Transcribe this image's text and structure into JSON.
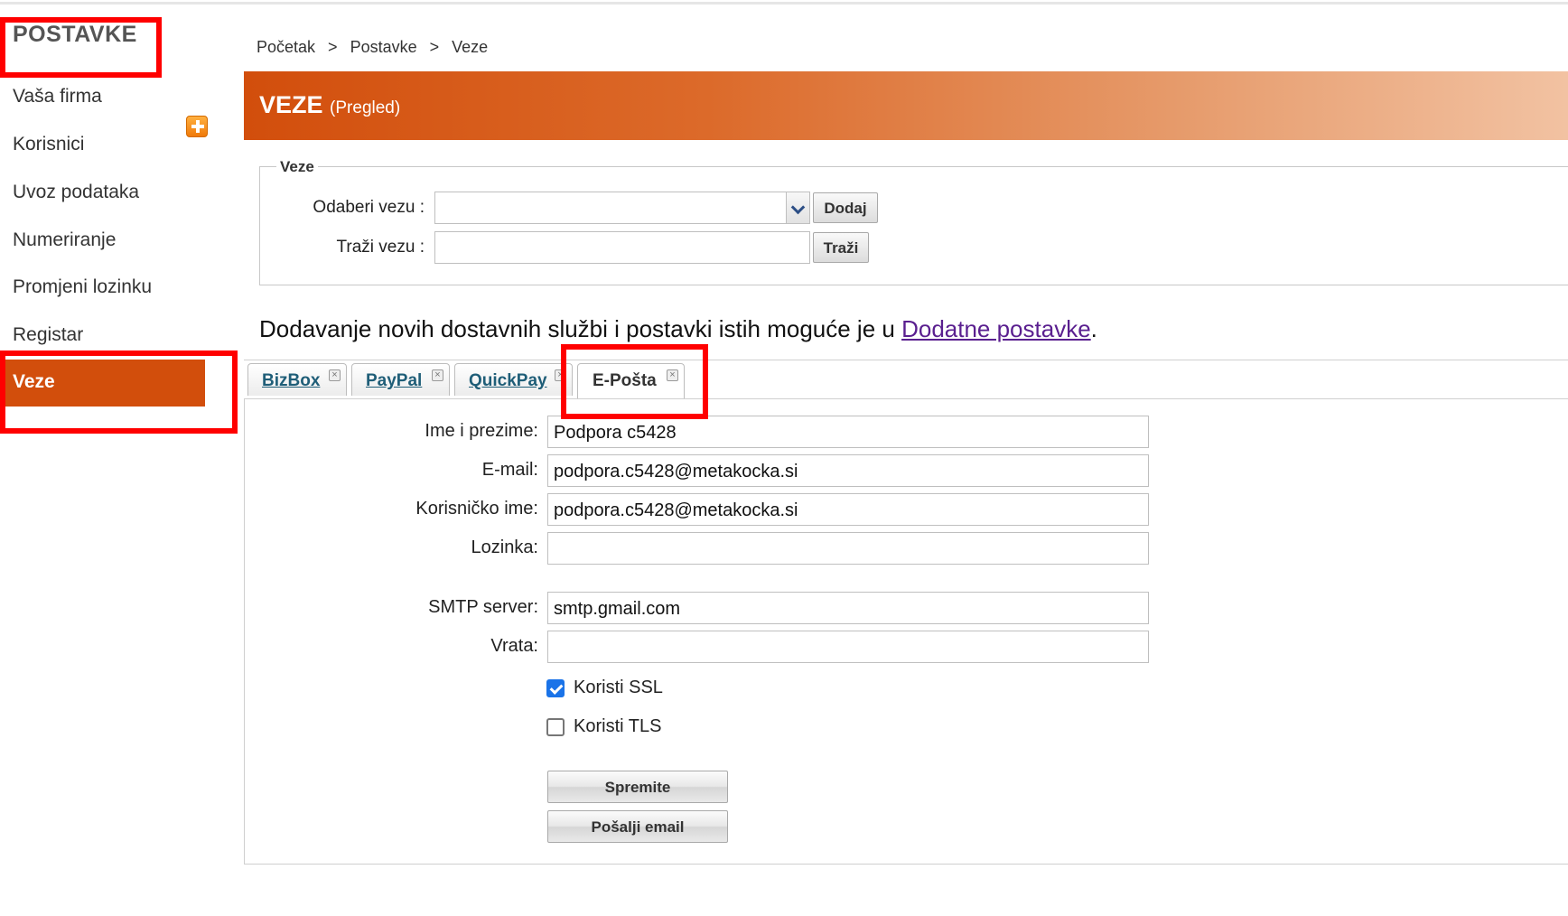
{
  "sidebar": {
    "title": "POSTAVKE",
    "items": [
      {
        "label": "Vaša firma"
      },
      {
        "label": "Korisnici"
      },
      {
        "label": "Uvoz podataka"
      },
      {
        "label": "Numeriranje"
      },
      {
        "label": "Promjeni lozinku"
      },
      {
        "label": "Registar"
      },
      {
        "label": "Veze"
      }
    ],
    "active_item": "Veze",
    "add_icon": "plus-icon"
  },
  "breadcrumb": {
    "items": [
      "Početak",
      "Postavke",
      "Veze"
    ],
    "separator": ">"
  },
  "header": {
    "title": "VEZE",
    "subtitle": "(Pregled)"
  },
  "connections": {
    "legend": "Veze",
    "select_label": "Odaberi vezu :",
    "select_value": "",
    "add_button": "Dodaj",
    "search_label": "Traži vezu :",
    "search_value": "",
    "search_button": "Traži"
  },
  "info": {
    "text": "Dodavanje novih dostavnih službi i postavki istih moguće je u ",
    "link": "Dodatne postavke",
    "suffix": "."
  },
  "tabs": [
    {
      "label": "BizBox",
      "active": false
    },
    {
      "label": "PayPal",
      "active": false
    },
    {
      "label": "QuickPay",
      "active": false
    },
    {
      "label": "E-Pošta",
      "active": true
    }
  ],
  "email_form": {
    "name_label": "Ime i prezime:",
    "name_value": "Podpora c5428",
    "email_label": "E-mail:",
    "email_value": "podpora.c5428@metakocka.si",
    "username_label": "Korisničko ime:",
    "username_value": "podpora.c5428@metakocka.si",
    "password_label": "Lozinka:",
    "password_value": "",
    "smtp_label": "SMTP server:",
    "smtp_value": "smtp.gmail.com",
    "port_label": "Vrata:",
    "port_value": "",
    "ssl_label": "Koristi SSL",
    "ssl_checked": true,
    "tls_label": "Koristi TLS",
    "tls_checked": false,
    "save_button": "Spremite",
    "send_button": "Pošalji email"
  },
  "colors": {
    "accent": "#d24e0c",
    "highlight": "#ff0000",
    "tab_link": "#1f5e78",
    "link": "#5a1f8f"
  }
}
